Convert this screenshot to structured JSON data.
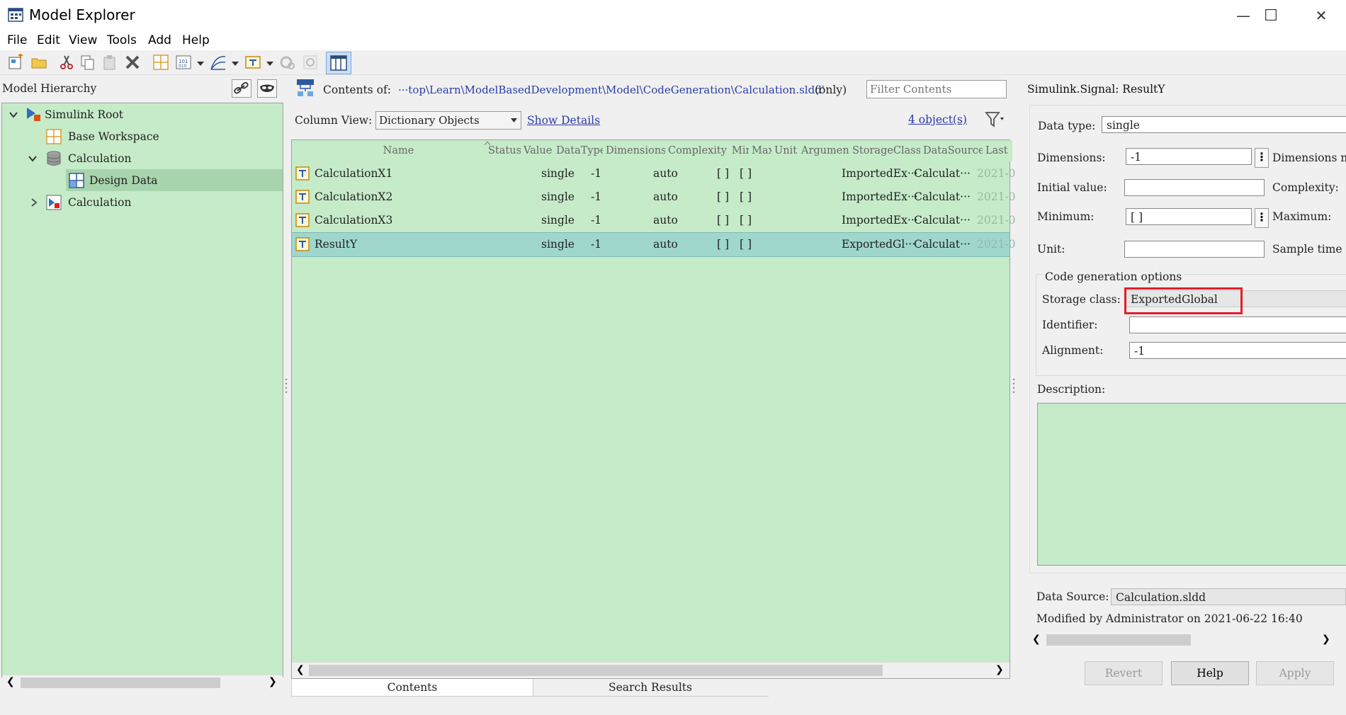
{
  "window": {
    "title": "Model Explorer",
    "minimize": "—",
    "maximize": "☐",
    "close": "✕"
  },
  "menu": [
    "File",
    "Edit",
    "View",
    "Tools",
    "Add",
    "Help"
  ],
  "left": {
    "title": "Model Hierarchy",
    "tree": [
      {
        "label": "Simulink Root"
      },
      {
        "label": "Base Workspace"
      },
      {
        "label": "Calculation"
      },
      {
        "label": "Design Data"
      },
      {
        "label": "Calculation"
      }
    ]
  },
  "middle": {
    "contents_prefix": "Contents of:",
    "contents_path": "···top\\Learn\\ModelBasedDevelopment\\Model\\CodeGeneration\\Calculation.sldd'",
    "contents_suffix": "(only)",
    "filter_placeholder": "Filter Contents",
    "column_view_label": "Column View:",
    "column_view_value": "Dictionary Objects",
    "show_details": "Show Details",
    "object_count": "4 object(s)",
    "columns": [
      "Name",
      "Status",
      "Value",
      "DataType",
      "Dimensions",
      "Complexity",
      "Min",
      "Max",
      "Unit",
      "Argument",
      "StorageClass",
      "DataSource",
      "Last"
    ],
    "rows": [
      {
        "name": "CalculationX1",
        "datatype": "single",
        "dimensions": "-1",
        "complexity": "auto",
        "min": "[ ]",
        "max": "[ ]",
        "storage": "ImportedEx···",
        "source": "Calculat···",
        "last": "2021-0"
      },
      {
        "name": "CalculationX2",
        "datatype": "single",
        "dimensions": "-1",
        "complexity": "auto",
        "min": "[ ]",
        "max": "[ ]",
        "storage": "ImportedEx···",
        "source": "Calculat···",
        "last": "2021-0"
      },
      {
        "name": "CalculationX3",
        "datatype": "single",
        "dimensions": "-1",
        "complexity": "auto",
        "min": "[ ]",
        "max": "[ ]",
        "storage": "ImportedEx···",
        "source": "Calculat···",
        "last": "2021-0"
      },
      {
        "name": "ResultY",
        "datatype": "single",
        "dimensions": "-1",
        "complexity": "auto",
        "min": "[ ]",
        "max": "[ ]",
        "storage": "ExportedGl···",
        "source": "Calculat···",
        "last": "2021-0"
      }
    ],
    "tabs": [
      "Contents",
      "Search Results"
    ]
  },
  "right": {
    "title": "Simulink.Signal: ResultY",
    "data_type_label": "Data type:",
    "data_type_value": "single",
    "dimensions_label": "Dimensions:",
    "dimensions_value": "-1",
    "dimensions_mode_label": "Dimensions m",
    "initial_value_label": "Initial value:",
    "initial_value_value": "",
    "complexity_label": "Complexity:",
    "minimum_label": "Minimum:",
    "minimum_value": "[ ]",
    "maximum_label": "Maximum:",
    "unit_label": "Unit:",
    "unit_value": "",
    "sample_time_label": "Sample time",
    "code_gen_title": "Code generation options",
    "storage_class_label": "Storage class:",
    "storage_class_value": "ExportedGlobal",
    "identifier_label": "Identifier:",
    "identifier_value": "",
    "alignment_label": "Alignment:",
    "alignment_value": "-1",
    "description_label": "Description:",
    "data_source_label": "Data Source:",
    "data_source_value": "Calculation.sldd",
    "modified_text": "Modified by Administrator on 2021-06-22 16:40",
    "buttons": {
      "revert": "Revert",
      "help": "Help",
      "apply": "Apply"
    },
    "highlight_color": "#e0202a"
  }
}
